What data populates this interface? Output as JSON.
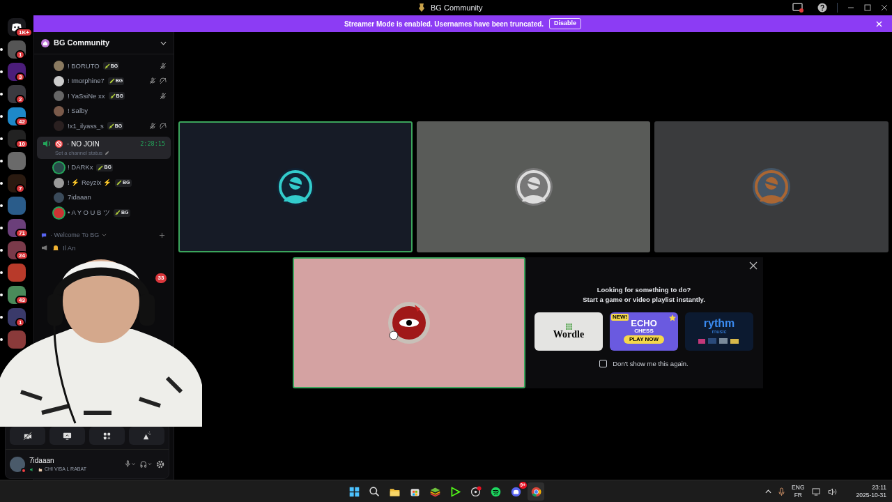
{
  "title_bar": {
    "title": "BG Community"
  },
  "banner": {
    "text": "Streamer Mode is enabled. Usernames have been truncated.",
    "button": "Disable"
  },
  "servers": [
    {
      "badge": "1K+",
      "unread": false
    },
    {
      "badge": "1",
      "unread": true
    },
    {
      "badge": "3",
      "unread": true
    },
    {
      "badge": "2",
      "unread": true
    },
    {
      "badge": "42",
      "unread": true
    },
    {
      "badge": "10",
      "unread": true
    },
    {
      "unread": true
    },
    {
      "badge": "7",
      "unread": true
    },
    {
      "unread": true
    },
    {
      "badge": "71",
      "unread": true
    },
    {
      "badge": "24",
      "unread": true
    },
    {
      "unread": true
    },
    {
      "badge": "43",
      "unread": true
    },
    {
      "badge": "1",
      "unread": true
    },
    {
      "unread": true
    }
  ],
  "guild": {
    "name": "BG Community",
    "members_above": [
      {
        "name": "! BORUTO",
        "tag": "BG",
        "muted": true,
        "deafened": false,
        "speaking": false
      },
      {
        "name": "! Imorphine7",
        "tag": "BG",
        "muted": true,
        "deafened": true,
        "speaking": false
      },
      {
        "name": "! YaSsiNe xx",
        "tag": "BG",
        "muted": true,
        "deafened": false,
        "speaking": false
      },
      {
        "name": "! Salby",
        "muted": false,
        "deafened": false,
        "speaking": false
      },
      {
        "name": "!x1_ilyass_s",
        "tag": "BG",
        "muted": true,
        "deafened": true,
        "speaking": false
      }
    ],
    "voice_channel": {
      "name": "· NO JOIN",
      "timer": "2:28:15",
      "status": "Set a channel status",
      "selected": true,
      "members": [
        {
          "name": "! DARKx",
          "tag": "BG",
          "muted": false,
          "deafened": false,
          "speaking": true
        },
        {
          "name": "! ⚡ Reyzix ⚡",
          "tag": "BG",
          "muted": false,
          "deafened": false,
          "speaking": false
        },
        {
          "name": "7idaaan",
          "muted": false,
          "deafened": false,
          "speaking": false
        },
        {
          "name": "• A Y O U B ツ",
          "tag": "BG",
          "muted": false,
          "deafened": false,
          "speaking": true
        }
      ]
    },
    "category": {
      "name": "· Welcome To BG",
      "expanded": true
    },
    "channel_partial": "Il An",
    "mention_badge": "33"
  },
  "controls": {
    "camera_off": true
  },
  "user": {
    "name": "7idaaan",
    "status": "CHI VISA L RABAT"
  },
  "tiles": [
    {
      "speaking": true,
      "color": "#161b26"
    },
    {
      "speaking": false,
      "color": "#595b58"
    },
    {
      "speaking": false,
      "color": "#3a3b3d"
    },
    {
      "speaking": true,
      "color": "#d4a2a2"
    }
  ],
  "activity": {
    "line1": "Looking for something to do?",
    "line2": "Start a game or video playlist instantly.",
    "cards": [
      {
        "kind": "wordle",
        "title": "Wordle"
      },
      {
        "kind": "chess",
        "ribbon": "NEW!",
        "title1": "ECHO",
        "title2": "CHESS",
        "button": "PLAY NOW"
      },
      {
        "kind": "rythm",
        "title": "rythm",
        "subtitle": "music"
      }
    ],
    "checkbox": {
      "label": "Don't show me this again.",
      "checked": false
    }
  },
  "taskbar": {
    "discord_badge": "9+",
    "lang1": "ENG",
    "lang2": "FR",
    "time": "23:11",
    "date": "2025-10-31"
  }
}
